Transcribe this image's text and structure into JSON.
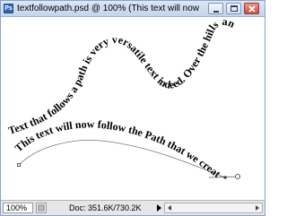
{
  "window": {
    "title": "textfollowpath.psd @ 100% (This text will now follow the Path...",
    "app_icon": "photoshop-document-icon",
    "buttons": {
      "minimize": "minimize-icon",
      "maximize": "maximize-icon",
      "close": "close-icon"
    }
  },
  "canvas": {
    "path_text_upper": "Text that follows a path is very versatile  text indeed. Over the hills and far away.....",
    "path_text_lower": "This text will now follow the Path that we created."
  },
  "statusbar": {
    "zoom": "100%",
    "doc_info": "Doc: 351.6K/730.2K"
  },
  "colors": {
    "titlebar": "#c4d4ec",
    "close_button": "#c9513b",
    "path_handle": "#555555"
  }
}
